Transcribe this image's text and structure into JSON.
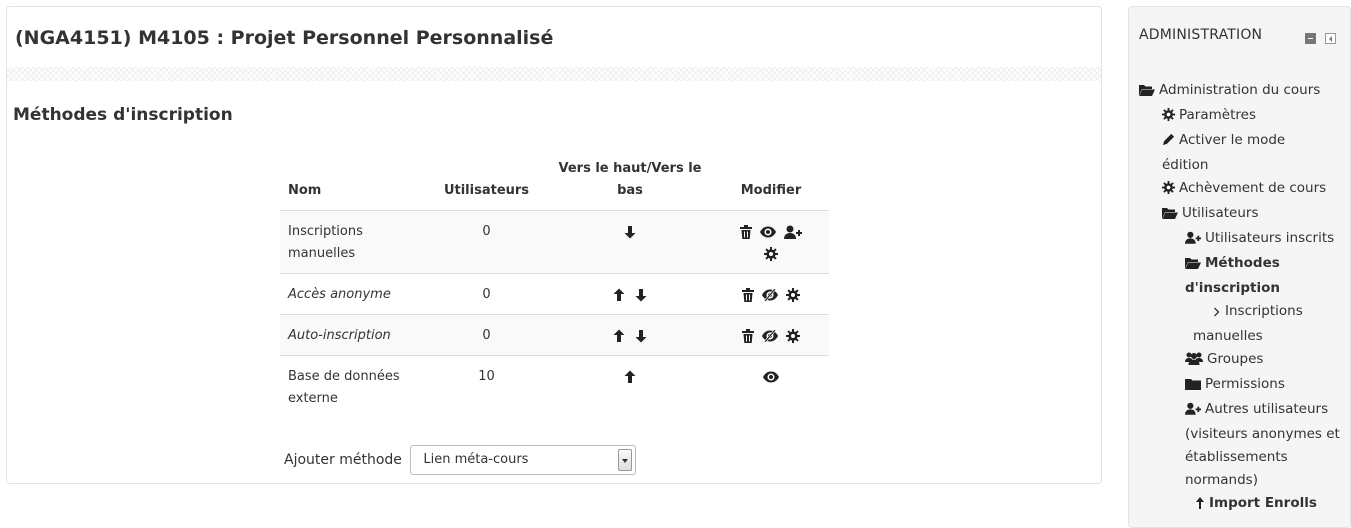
{
  "course": {
    "title": "(NGA4151) M4105 : Projet Personnel Personnalisé"
  },
  "section": {
    "title": "Méthodes d'inscription"
  },
  "table": {
    "headers": {
      "name": "Nom",
      "users": "Utilisateurs",
      "updown": "Vers le haut/Vers le bas",
      "edit": "Modifier"
    },
    "rows": [
      {
        "name": "Inscriptions manuelles",
        "users": "0",
        "italic": false,
        "up": false,
        "down": true,
        "edit": [
          "delete-icon",
          "eye-icon",
          "enrol-user-icon",
          "gear-icon"
        ]
      },
      {
        "name": "Accès anonyme",
        "users": "0",
        "italic": true,
        "up": true,
        "down": true,
        "edit": [
          "delete-icon",
          "eye-slash-icon",
          "gear-icon"
        ]
      },
      {
        "name": "Auto-inscription",
        "users": "0",
        "italic": true,
        "up": true,
        "down": true,
        "edit": [
          "delete-icon",
          "eye-slash-icon",
          "gear-icon"
        ]
      },
      {
        "name": "Base de données externe",
        "users": "10",
        "italic": false,
        "up": true,
        "down": false,
        "edit": [
          "eye-icon"
        ]
      }
    ]
  },
  "add_method": {
    "label": "Ajouter méthode",
    "selected": "Lien méta-cours"
  },
  "admin": {
    "title": "ADMINISTRATION",
    "items": [
      {
        "label": "Administration du cours",
        "icon": "folder-open-icon"
      },
      {
        "label": "Paramètres",
        "icon": "gear-icon"
      },
      {
        "label": "Activer le mode édition",
        "icon": "pencil-icon"
      },
      {
        "label": "Achèvement de cours",
        "icon": "gear-icon"
      },
      {
        "label": "Utilisateurs",
        "icon": "folder-open-icon"
      },
      {
        "label": "Utilisateurs inscrits",
        "icon": "enrol-user-icon"
      },
      {
        "label": "Méthodes d'inscription",
        "icon": "folder-open-icon"
      },
      {
        "label": "Inscriptions manuelles",
        "icon": "chevron-right-icon"
      },
      {
        "label": "Groupes",
        "icon": "users-icon"
      },
      {
        "label": "Permissions",
        "icon": "folder-icon"
      },
      {
        "label": "Autres utilisateurs (visiteurs anonymes et établissements normands)",
        "icon": "enrol-user-icon"
      },
      {
        "label": "Import Enrolls",
        "icon": "arrow-up-icon"
      }
    ]
  }
}
